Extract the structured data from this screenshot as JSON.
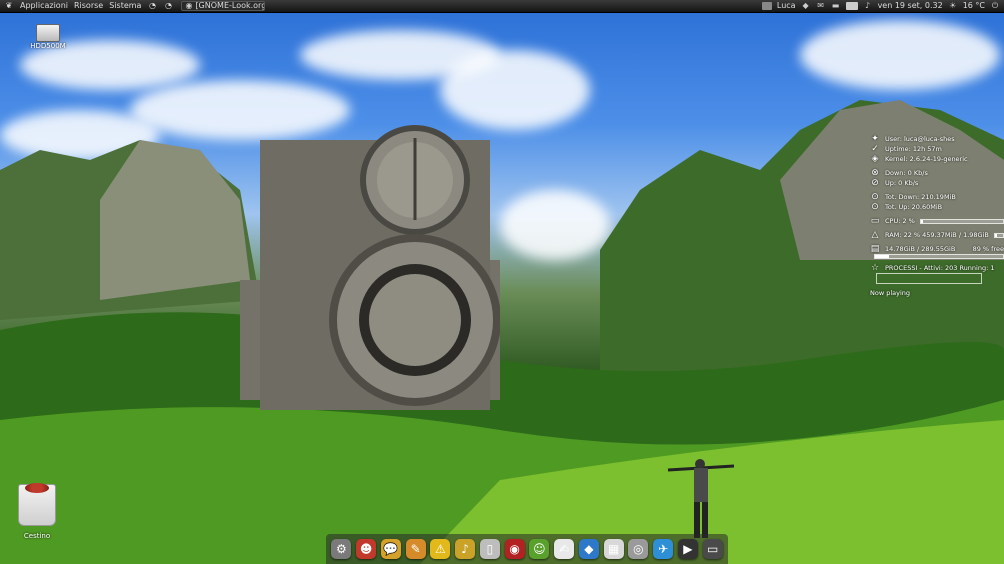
{
  "top_panel": {
    "menus": [
      "Applicazioni",
      "Risorse",
      "Sistema"
    ],
    "window_button_label": "[GNOME-Look.org - ...",
    "user": "Luca",
    "clock": "ven 19 set, 0.32",
    "temperature": "16 °C"
  },
  "desktop_icons": {
    "hdd_label": "HDD500M",
    "trash_label": "Cestino"
  },
  "conky": {
    "user": "User: luca@luca-shes",
    "uptime": "Uptime:  12h 57m",
    "kernel": "Kernel: 2.6.24-19-generic",
    "down": "Down: 0   Kb/s",
    "up": "Up: 0   Kb/s",
    "tot_down": "Tot. Down: 210.19MiB",
    "tot_up": "Tot. Up: 20.60MiB",
    "cpu": "CPU:  2 %",
    "cpu_percent": 2,
    "ram": "RAM: 22 % 459.37MiB / 1.98GiB",
    "ram_percent": 22,
    "disk_used": "14.78GiB / 289.55GiB",
    "disk_free": "89 % free",
    "disk_used_percent": 11,
    "processes": "PROCESSI - Attivi: 203   Running: 1",
    "now_playing": "Now playing"
  },
  "dock": {
    "items": [
      {
        "name": "system-settings-icon",
        "glyph": "⚙",
        "color": "#7a7a7a"
      },
      {
        "name": "firefox-icon",
        "glyph": "☻",
        "color": "#c0392b"
      },
      {
        "name": "pidgin-chat-icon",
        "glyph": "💬",
        "color": "#d6a12a"
      },
      {
        "name": "gimp-icon",
        "glyph": "✎",
        "color": "#d68b2a"
      },
      {
        "name": "warning-tool-icon",
        "glyph": "⚠",
        "color": "#e3b81b"
      },
      {
        "name": "music-icon",
        "glyph": "♪",
        "color": "#c9a227"
      },
      {
        "name": "ipod-icon",
        "glyph": "▯",
        "color": "#bdbdbd"
      },
      {
        "name": "red-app-icon",
        "glyph": "◉",
        "color": "#b22222"
      },
      {
        "name": "frog-app-icon",
        "glyph": "☺",
        "color": "#5aa02c"
      },
      {
        "name": "document-edit-icon",
        "glyph": "✍",
        "color": "#e8e8e8"
      },
      {
        "name": "blue-folder-icon",
        "glyph": "◆",
        "color": "#2d78c8"
      },
      {
        "name": "calendar-icon",
        "glyph": "▦",
        "color": "#d8d8d8"
      },
      {
        "name": "harddisk-icon",
        "glyph": "◎",
        "color": "#9a9a9a"
      },
      {
        "name": "bird-app-icon",
        "glyph": "✈",
        "color": "#2f8fd6"
      },
      {
        "name": "terminal-icon",
        "glyph": "▶",
        "color": "#333333"
      },
      {
        "name": "laptop-icon",
        "glyph": "▭",
        "color": "#4a4a4a"
      }
    ]
  }
}
